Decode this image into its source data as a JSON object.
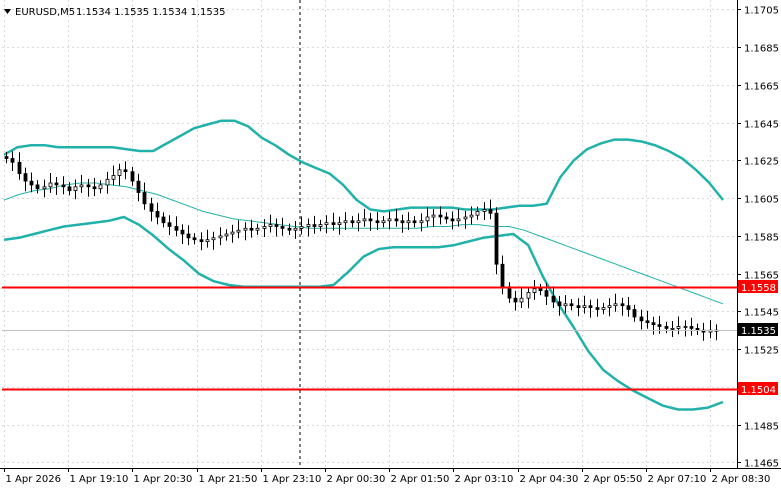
{
  "header": {
    "symbol": "EURUSD,M5",
    "ohlc": "1.1534 1.1535 1.1534 1.1535"
  },
  "colors": {
    "background": "#ffffff",
    "grid": "#d9d9d9",
    "candle": "#000000",
    "bollinger_outer": "#20b2aa",
    "bollinger_mid": "#20b2aa",
    "level_line": "#ff0000",
    "price_line": "#c0c0c0"
  },
  "chart_data": {
    "type": "candlestick",
    "y_ticks": [
      "1.1705",
      "1.1685",
      "1.1665",
      "1.1645",
      "1.1625",
      "1.1605",
      "1.1585",
      "1.1565",
      "1.1545",
      "1.1525",
      "1.1505",
      "1.1485",
      "1.1465"
    ],
    "x_ticks": [
      "1 Apr 2026",
      "1 Apr 19:10",
      "1 Apr 20:30",
      "1 Apr 21:50",
      "1 Apr 23:10",
      "2 Apr 00:30",
      "2 Apr 01:50",
      "2 Apr 03:10",
      "2 Apr 04:30",
      "2 Apr 05:50",
      "2 Apr 07:10",
      "2 Apr 08:30"
    ],
    "ylim": [
      1.1462,
      1.171
    ],
    "horizontal_levels": [
      {
        "label": "1.1558",
        "value": 1.1558
      },
      {
        "label": "1.1504",
        "value": 1.1504
      }
    ],
    "current_price": {
      "label": "1.1535",
      "value": 1.1535
    },
    "close_series": [
      1.1626,
      1.1624,
      1.1618,
      1.1614,
      1.1612,
      1.161,
      1.1611,
      1.1613,
      1.1612,
      1.1611,
      1.1609,
      1.1611,
      1.1612,
      1.1611,
      1.161,
      1.1612,
      1.1615,
      1.1617,
      1.162,
      1.1619,
      1.1614,
      1.1608,
      1.1602,
      1.1598,
      1.1595,
      1.1592,
      1.159,
      1.1588,
      1.1586,
      1.1584,
      1.1583,
      1.1582,
      1.1583,
      1.1584,
      1.1585,
      1.1586,
      1.1587,
      1.1588,
      1.1589,
      1.1588,
      1.1589,
      1.159,
      1.1591,
      1.159,
      1.1589,
      1.1588,
      1.1589,
      1.159,
      1.1591,
      1.159,
      1.1591,
      1.1592,
      1.1591,
      1.1592,
      1.1593,
      1.1592,
      1.1593,
      1.1594,
      1.1593,
      1.1592,
      1.1593,
      1.1594,
      1.1593,
      1.1592,
      1.1593,
      1.1592,
      1.1593,
      1.1595,
      1.1596,
      1.1595,
      1.1594,
      1.1593,
      1.1594,
      1.1595,
      1.1596,
      1.1598,
      1.1599,
      1.1597,
      1.157,
      1.1558,
      1.1552,
      1.155,
      1.1552,
      1.1555,
      1.1557,
      1.1556,
      1.1553,
      1.155,
      1.1548,
      1.1549,
      1.1548,
      1.1547,
      1.1548,
      1.1547,
      1.1546,
      1.1547,
      1.1548,
      1.1549,
      1.1548,
      1.1546,
      1.1542,
      1.154,
      1.1539,
      1.1538,
      1.1537,
      1.1536,
      1.1536,
      1.1537,
      1.1537,
      1.1536,
      1.1535,
      1.1534,
      1.1535,
      1.1535
    ],
    "bollinger_upper": [
      1.1628,
      1.1632,
      1.1633,
      1.1633,
      1.1632,
      1.1632,
      1.1632,
      1.1632,
      1.1632,
      1.1631,
      1.163,
      1.163,
      1.1634,
      1.1638,
      1.1642,
      1.1644,
      1.1646,
      1.1646,
      1.1643,
      1.1637,
      1.1633,
      1.1628,
      1.1624,
      1.1621,
      1.1618,
      1.1612,
      1.1604,
      1.1599,
      1.1598,
      1.1599,
      1.16,
      1.16,
      1.16,
      1.16,
      1.1599,
      1.1599,
      1.1599,
      1.16,
      1.1601,
      1.1601,
      1.1602,
      1.1616,
      1.1625,
      1.1631,
      1.1634,
      1.1636,
      1.1636,
      1.1635,
      1.1633,
      1.163,
      1.1626,
      1.162,
      1.1613,
      1.1604
    ],
    "bollinger_middle": [
      1.1604,
      1.1607,
      1.1609,
      1.161,
      1.1612,
      1.1613,
      1.1613,
      1.1612,
      1.1611,
      1.1609,
      1.1607,
      1.1604,
      1.1601,
      1.1598,
      1.1596,
      1.1594,
      1.1593,
      1.1592,
      1.1591,
      1.159,
      1.1589,
      1.1589,
      1.1589,
      1.1589,
      1.1589,
      1.1589,
      1.1589,
      1.1589,
      1.159,
      1.159,
      1.1591,
      1.1591,
      1.159,
      1.159,
      1.1588,
      1.1585,
      1.1582,
      1.1579,
      1.1576,
      1.1573,
      1.157,
      1.1567,
      1.1564,
      1.1561,
      1.1558,
      1.1555,
      1.1552,
      1.1549
    ],
    "bollinger_lower": [
      1.1583,
      1.1584,
      1.1586,
      1.1588,
      1.159,
      1.1591,
      1.1592,
      1.1593,
      1.1595,
      1.1591,
      1.1585,
      1.1578,
      1.1572,
      1.1565,
      1.1561,
      1.1559,
      1.1558,
      1.1558,
      1.1558,
      1.1558,
      1.1558,
      1.1558,
      1.1559,
      1.1566,
      1.1574,
      1.1578,
      1.1579,
      1.1579,
      1.1579,
      1.1579,
      1.158,
      1.1582,
      1.1584,
      1.1585,
      1.1586,
      1.158,
      1.1563,
      1.1549,
      1.1537,
      1.1524,
      1.1514,
      1.1508,
      1.1503,
      1.1499,
      1.1495,
      1.1493,
      1.1493,
      1.1494,
      1.1497
    ]
  }
}
